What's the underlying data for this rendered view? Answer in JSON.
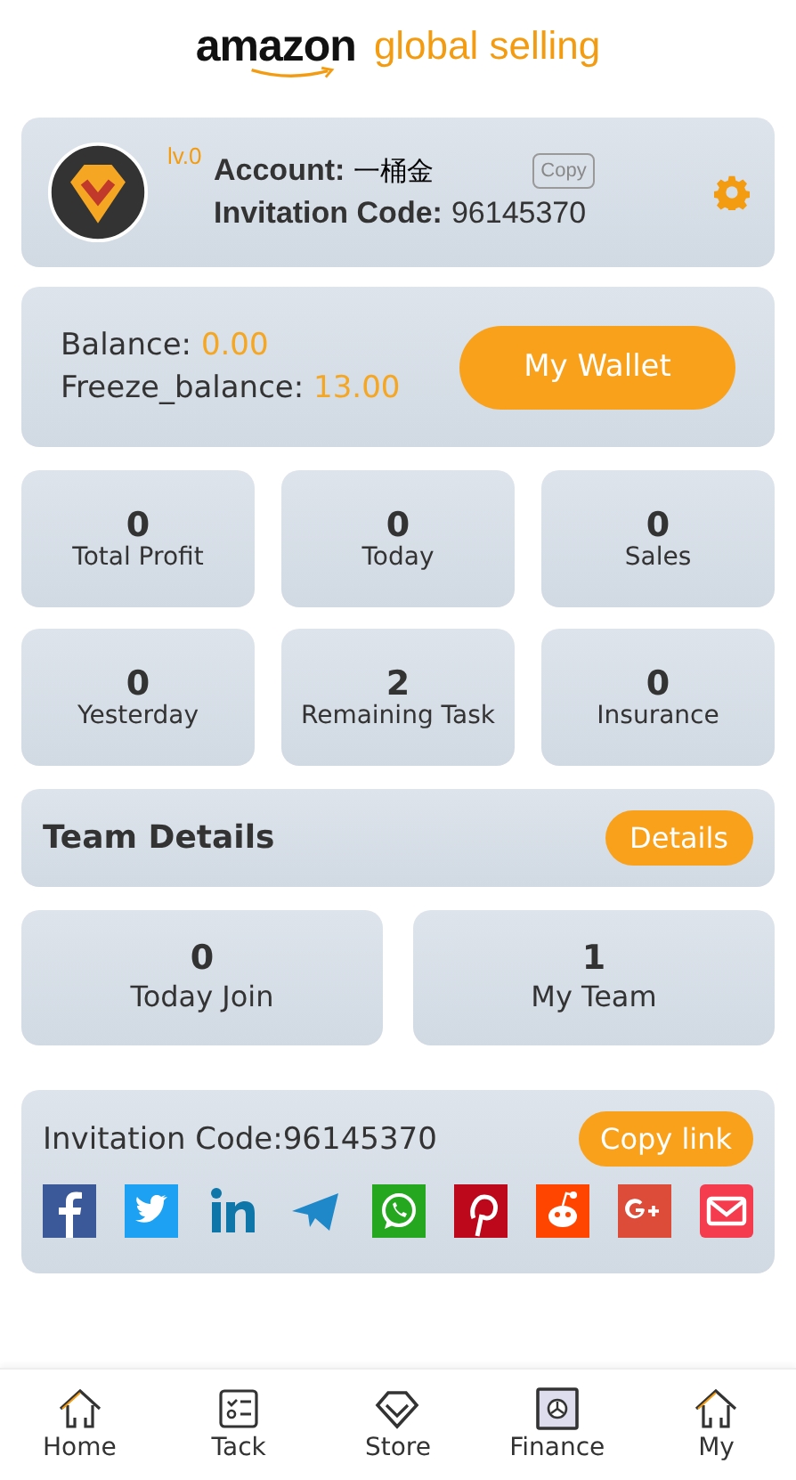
{
  "header": {
    "brand": "amazon",
    "tagline": "global selling"
  },
  "profile": {
    "level": "lv.0",
    "account_label": "Account:",
    "account": "一桶金",
    "copy_button": "Copy",
    "invitation_label": "Invitation Code:",
    "invitation_code": "96145370"
  },
  "balance": {
    "balance_label": "Balance:",
    "balance": "0.00",
    "freeze_label": "Freeze_balance:",
    "freeze": "13.00",
    "wallet_button": "My Wallet"
  },
  "stats": [
    {
      "value": "0",
      "label": "Total Profit"
    },
    {
      "value": "0",
      "label": "Today"
    },
    {
      "value": "0",
      "label": "Sales"
    },
    {
      "value": "0",
      "label": "Yesterday"
    },
    {
      "value": "2",
      "label": "Remaining Task"
    },
    {
      "value": "0",
      "label": "Insurance"
    }
  ],
  "team": {
    "title": "Team Details",
    "button": "Details"
  },
  "team_stats": [
    {
      "value": "0",
      "label": "Today Join"
    },
    {
      "value": "1",
      "label": "My Team"
    }
  ],
  "invite": {
    "text": "Invitation Code:96145370",
    "button": "Copy link"
  },
  "nav": [
    {
      "kind": "home",
      "label": "Home"
    },
    {
      "kind": "task",
      "label": "Tack"
    },
    {
      "kind": "store",
      "label": "Store"
    },
    {
      "kind": "finance",
      "label": "Finance"
    },
    {
      "kind": "home",
      "label": "My"
    }
  ]
}
